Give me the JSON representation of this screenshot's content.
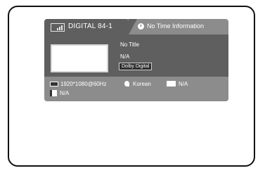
{
  "banner": {
    "channel": "DIGITAL 84-1",
    "time_info": "No Time Information",
    "program_title": "No Title",
    "audio_info": "N/A",
    "audio_badge": "Dolby Digital"
  },
  "details": {
    "resolution": "1920*1080@60Hz",
    "language": "Korean",
    "subtitle": "N/A",
    "extra": "N/A"
  }
}
